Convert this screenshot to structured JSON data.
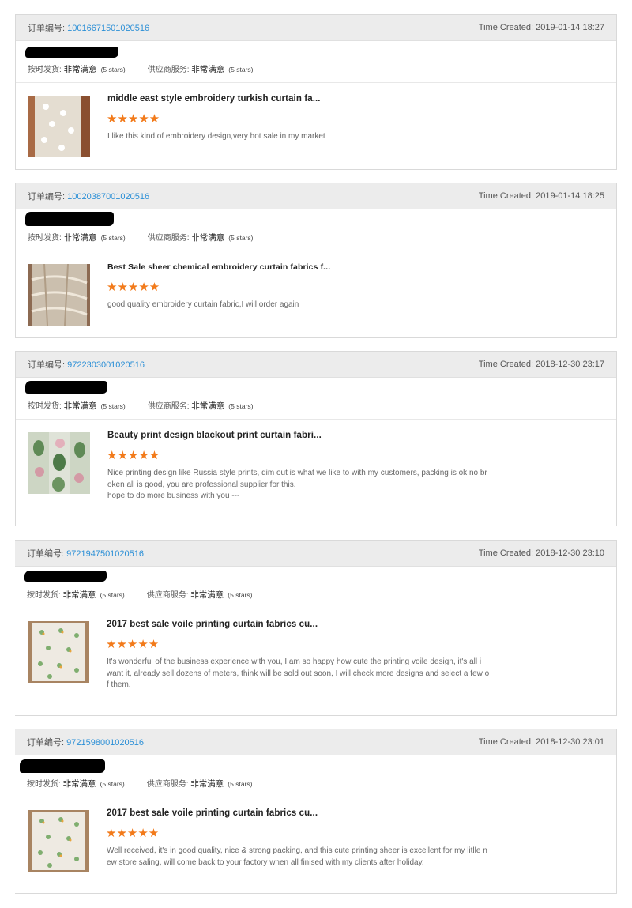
{
  "labels": {
    "order_no": "订单编号: ",
    "time_created": "Time Created: ",
    "ontime": "按时发货: ",
    "supplier": "供应商服务: ",
    "rating_word": "非常满意",
    "stars_text": "(5 stars)",
    "star_glyphs": "★★★★★"
  },
  "orders": [
    {
      "order_id": "10016671501020516",
      "time": "2019-01-14 18:27",
      "product_title": "middle east style embroidery turkish curtain fa...",
      "rating": 5,
      "review_lines": [
        "I like this kind of embroidery design,very hot sale in my market"
      ]
    },
    {
      "order_id": "10020387001020516",
      "time": "2019-01-14 18:25",
      "product_title": "Best Sale sheer chemical embroidery curtain fabrics f...",
      "rating": 5,
      "review_lines": [
        "good quality embroidery curtain fabric,I will order again"
      ]
    },
    {
      "order_id": "9722303001020516",
      "time": "2018-12-30 23:17",
      "product_title": "Beauty print design blackout print curtain fabri...",
      "rating": 5,
      "review_lines": [
        "Nice printing design like Russia style prints, dim out is what we like to with my customers, packing is ok no br",
        "oken all is good, you are professional supplier for this.",
        "hope to do more business with you ---"
      ]
    },
    {
      "order_id": "9721947501020516",
      "time": "2018-12-30 23:10",
      "product_title": "2017 best sale voile printing curtain fabrics cu...",
      "rating": 5,
      "review_lines": [
        "It's wonderful of the business experience with you, I am so happy how cute the printing voile design, it's all i",
        "want it, already sell dozens of meters, think will be sold out soon, I will check more designs and select a few o",
        "f them."
      ]
    },
    {
      "order_id": "9721598001020516",
      "time": "2018-12-30 23:01",
      "product_title": "2017 best sale voile printing curtain fabrics cu...",
      "rating": 5,
      "review_lines": [
        "Well received, it's in good quality, nice & strong packing, and this cute printing sheer is excellent for my litlle n",
        "ew store saling, will come back to your factory when all finised with my clients after holiday."
      ]
    }
  ]
}
